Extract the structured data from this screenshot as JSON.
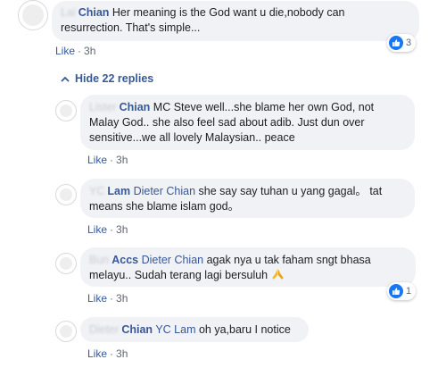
{
  "comments": [
    {
      "author_blurred": "Lai",
      "author": "Chian",
      "text_line1": "Her meaning is the God want u die,nobody can",
      "text_line2": "resurrection. That's simple...",
      "like": "Like",
      "time": "3h",
      "reaction_count": "3"
    }
  ],
  "hide_replies": "Hide 22 replies",
  "replies": [
    {
      "author_blurred": "Lister",
      "author": "Chian",
      "line1": "MC Steve well...she blame her own God, not",
      "line2": "Malay God.. she also feel sad about adib. Just dun over",
      "line3": "sensitive...we all lovely Malaysian.. peace",
      "like": "Like",
      "time": "3h"
    },
    {
      "author_blurred": "YC",
      "author": "Lam",
      "mention": "Dieter Chian",
      "line1_rest": "she say say tuhan u yang gagal。 tat",
      "line2": "means she blame islam god。",
      "like": "Like",
      "time": "3h"
    },
    {
      "author_blurred": "Bun",
      "author": "Accs",
      "mention": "Dieter Chian",
      "line1_rest": "agak nya u tak faham sngt bhasa",
      "line2": "melayu.. Sudah terang lagi bersuluh",
      "like": "Like",
      "time": "3h",
      "reaction_count": "1"
    },
    {
      "author_blurred": "Dieter",
      "author": "Chian",
      "mention": "YC Lam",
      "line1_rest": "oh ya,baru I notice",
      "like": "Like",
      "time": "3h"
    }
  ],
  "separator": "·",
  "icons": [
    "like-icon",
    "chevron-up-icon",
    "praying-hands-icon",
    "avatar-icon"
  ],
  "colors": {
    "link": "#385898",
    "bubble": "#f0f2f5",
    "like_badge": "#1877f2",
    "meta": "#606770"
  }
}
